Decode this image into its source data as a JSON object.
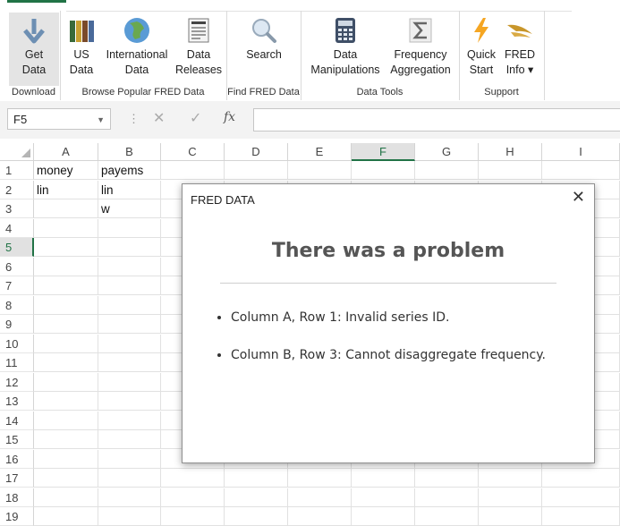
{
  "ribbon": {
    "buttons": [
      {
        "name": "get-data",
        "label": "Get\nData",
        "icon": "arrow-down-icon"
      },
      {
        "name": "us-data",
        "label": "US\nData",
        "icon": "books-icon"
      },
      {
        "name": "international-data",
        "label": "International\nData",
        "icon": "globe-icon"
      },
      {
        "name": "data-releases",
        "label": "Data\nReleases",
        "icon": "newspaper-icon"
      },
      {
        "name": "search",
        "label": "Search",
        "icon": "magnifier-icon"
      },
      {
        "name": "data-manipulations",
        "label": "Data\nManipulations",
        "icon": "calculator-icon"
      },
      {
        "name": "frequency-aggregation",
        "label": "Frequency\nAggregation",
        "icon": "sigma-icon"
      },
      {
        "name": "quick-start",
        "label": "Quick\nStart",
        "icon": "lightning-icon"
      },
      {
        "name": "fred-info",
        "label": "FRED\nInfo ▾",
        "icon": "eagle-icon"
      }
    ],
    "groups": [
      "Download",
      "Browse Popular FRED Data",
      "Find FRED Data",
      "Data Tools",
      "Support"
    ]
  },
  "formula_bar": {
    "name_box": "F5",
    "fx_label": "fx",
    "value": ""
  },
  "sheet": {
    "columns": [
      "A",
      "B",
      "C",
      "D",
      "E",
      "F",
      "G",
      "H",
      "I"
    ],
    "selected_column": "F",
    "rows": [
      "1",
      "2",
      "3",
      "4",
      "5",
      "6",
      "7",
      "8",
      "9",
      "10",
      "11",
      "12",
      "13",
      "14",
      "15",
      "16",
      "17",
      "18",
      "19"
    ],
    "selected_row": "5",
    "cells": {
      "A1": "money",
      "B1": "payems",
      "A2": "lin",
      "B2": "lin",
      "B3": "w"
    }
  },
  "dialog": {
    "title": "FRED DATA",
    "close_label": "✕",
    "heading": "There was a problem",
    "errors": [
      "Column A, Row 1: Invalid series ID.",
      "Column B, Row 3: Cannot disaggregate frequency."
    ]
  },
  "colors": {
    "accent": "#217346",
    "dialog_heading": "#555555"
  }
}
